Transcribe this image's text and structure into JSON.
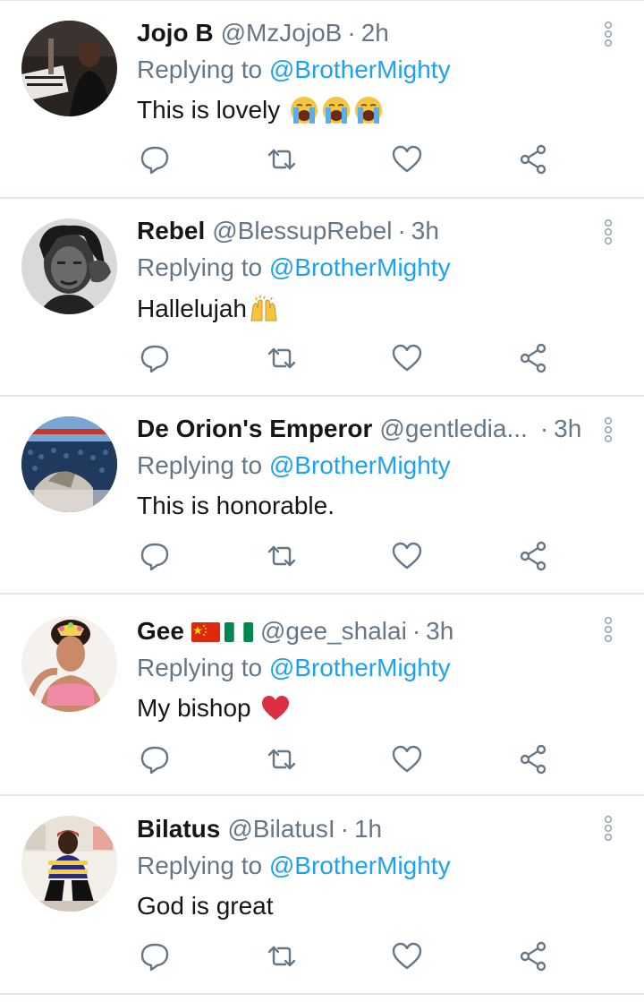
{
  "tweets": [
    {
      "name": "Jojo B",
      "handle": "@MzJojoB",
      "dot": "·",
      "time": "2h",
      "reply_prefix": "Replying to",
      "reply_to": "@BrotherMighty",
      "text": "This is lovely",
      "emoji": [
        "crying-face",
        "crying-face",
        "crying-face"
      ]
    },
    {
      "name": "Rebel",
      "handle": "@BlessupRebel",
      "dot": "·",
      "time": "3h",
      "reply_prefix": "Replying to",
      "reply_to": "@BrotherMighty",
      "text": "Hallelujah",
      "emoji": [
        "raising-hands"
      ]
    },
    {
      "name": "De Orion's Emperor",
      "handle": "@gentledia...",
      "dot": "·",
      "time": "3h",
      "reply_prefix": "Replying to",
      "reply_to": "@BrotherMighty",
      "text": "This is honorable.",
      "emoji": []
    },
    {
      "name": "Gee",
      "flags": [
        "china-flag",
        "nigeria-flag"
      ],
      "handle": "@gee_shalai",
      "dot": "·",
      "time": "3h",
      "reply_prefix": "Replying to",
      "reply_to": "@BrotherMighty",
      "text": "My bishop",
      "emoji": [
        "red-heart"
      ]
    },
    {
      "name": "Bilatus",
      "handle": "@BilatusI",
      "dot": "·",
      "time": "1h",
      "reply_prefix": "Replying to",
      "reply_to": "@BrotherMighty",
      "text": "God is great",
      "emoji": []
    }
  ],
  "action_icons": [
    "reply-icon",
    "retweet-icon",
    "like-icon",
    "share-icon"
  ],
  "more_icon": "more-options-icon",
  "colors": {
    "text": "#14171a",
    "secondary": "#657786",
    "mention": "#1da1f2",
    "divider": "#e1e8ed",
    "heart": "#e0245e"
  }
}
